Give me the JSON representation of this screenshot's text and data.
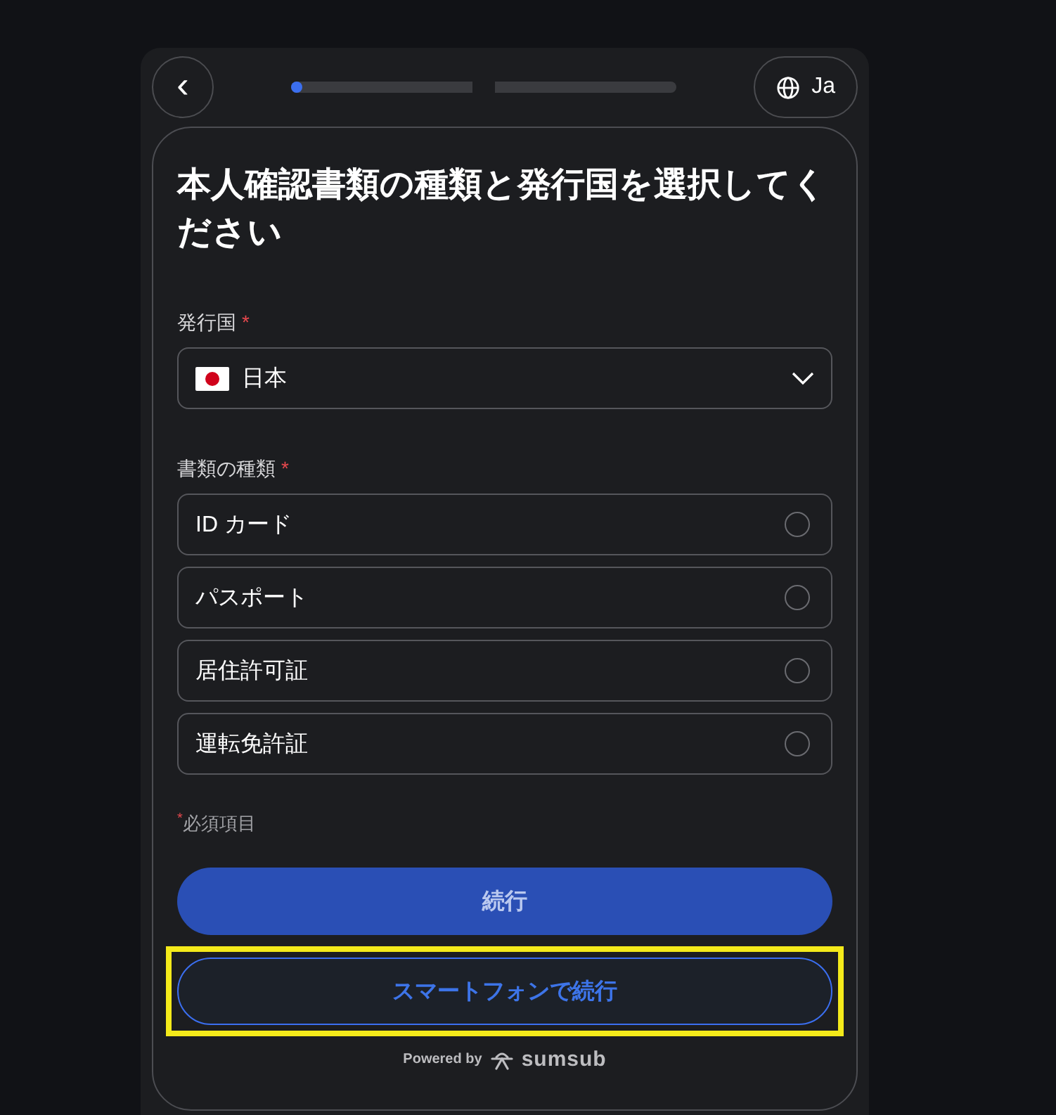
{
  "header": {
    "back_button": {
      "label": "‹"
    },
    "progress": {
      "level": 0.03
    },
    "language_button": {
      "label": "Ja"
    }
  },
  "card": {
    "title": "本人確認書類の種類と発行国を選択してください",
    "country": {
      "label": "発行国",
      "required_mark": "*",
      "value": "日本"
    },
    "document_type": {
      "label": "書類の種類",
      "required_mark": "*",
      "options": [
        {
          "label": "ID カード",
          "selected": false
        },
        {
          "label": "パスポート",
          "selected": false
        },
        {
          "label": "居住許可証",
          "selected": false
        },
        {
          "label": "運転免許証",
          "selected": false
        }
      ]
    },
    "required_note": {
      "mark": "*",
      "text": "必須項目"
    },
    "buttons": [
      {
        "kind": "primary",
        "label": "続行",
        "highlighted": false
      },
      {
        "kind": "outline",
        "label": "スマートフォンで続行",
        "highlighted": true
      }
    ],
    "footer": {
      "powered_by": "Powered by",
      "brand": "sumsub"
    }
  }
}
